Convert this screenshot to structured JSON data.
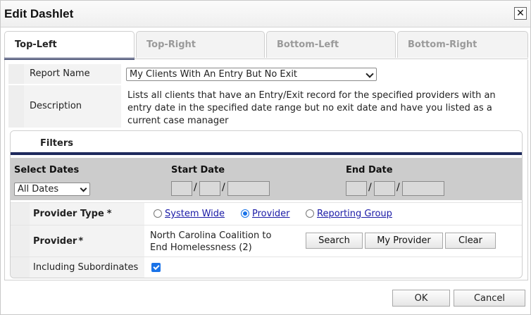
{
  "dialog": {
    "title": "Edit Dashlet",
    "close_icon": "close-icon"
  },
  "tabs": [
    {
      "label": "Top-Left",
      "active": true
    },
    {
      "label": "Top-Right",
      "active": false
    },
    {
      "label": "Bottom-Left",
      "active": false
    },
    {
      "label": "Bottom-Right",
      "active": false
    }
  ],
  "report": {
    "name_label": "Report Name",
    "selected": "My Clients With An Entry But No Exit",
    "description_label": "Description",
    "description": "Lists all clients that have an Entry/Exit record for the specified providers with an entry date in the specified date range but no exit date and have you listed as a current case manager"
  },
  "filters": {
    "title": "Filters",
    "select_dates_label": "Select Dates",
    "select_dates_value": "All Dates",
    "start_date_label": "Start Date",
    "end_date_label": "End Date",
    "date_separator": "/",
    "provider_type_label": "Provider Type",
    "required_marker": "*",
    "provider_type_options": [
      {
        "label": "System Wide",
        "selected": false
      },
      {
        "label": "Provider",
        "selected": true
      },
      {
        "label": "Reporting Group",
        "selected": false
      }
    ],
    "provider_label": "Provider",
    "provider_value_line1": "North Carolina Coalition to",
    "provider_value_line2": "End Homelessness (2)",
    "search_button": "Search",
    "my_provider_button": "My Provider",
    "clear_button": "Clear",
    "subordinates_label": "Including Subordinates",
    "subordinates_checked": true
  },
  "footer": {
    "ok_button": "OK",
    "cancel_button": "Cancel"
  },
  "colors": {
    "accent": "#1f2a5c",
    "link": "#1a1aa6",
    "checkbox": "#1a73e8",
    "date_band": "#cccccc"
  }
}
